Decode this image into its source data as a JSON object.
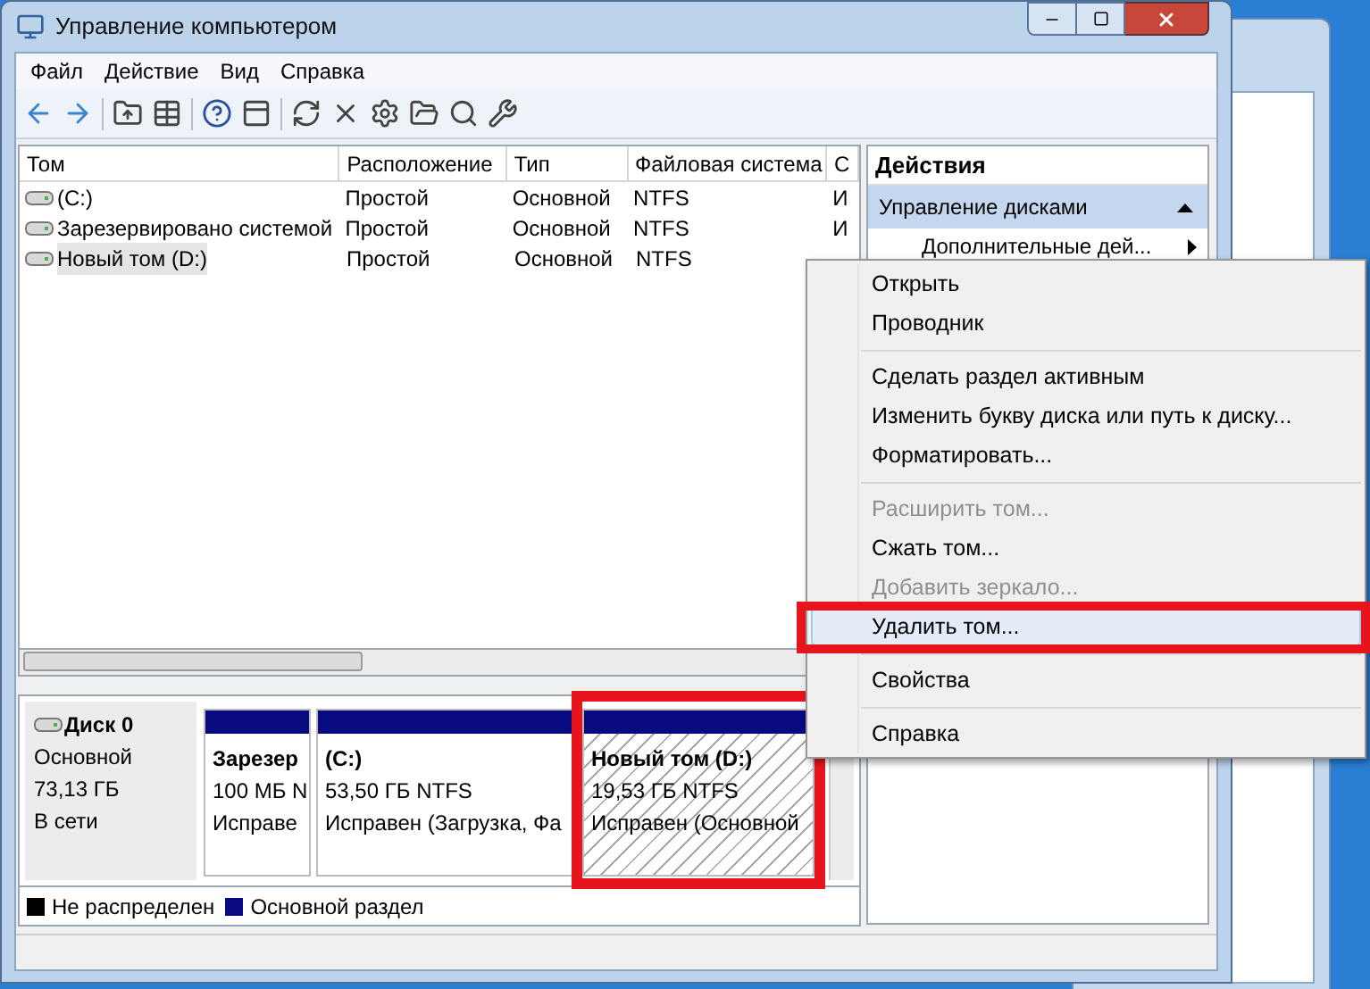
{
  "window": {
    "title": "Управление компьютером"
  },
  "menu_bar": [
    "Файл",
    "Действие",
    "Вид",
    "Справка"
  ],
  "volumes_table": {
    "columns": [
      "Том",
      "Расположение",
      "Тип",
      "Файловая система",
      "С"
    ],
    "rows": [
      {
        "cells": [
          "(C:)",
          "Простой",
          "Основной",
          "NTFS",
          "И"
        ],
        "selected": false
      },
      {
        "cells": [
          "Зарезервировано системой",
          "Простой",
          "Основной",
          "NTFS",
          "И"
        ],
        "selected": false
      },
      {
        "cells": [
          "Новый том (D:)",
          "Простой",
          "Основной",
          "NTFS"
        ],
        "selected": true
      }
    ]
  },
  "disk": {
    "name": "Диск 0",
    "type": "Основной",
    "size": "73,13 ГБ",
    "status": "В сети",
    "partitions": [
      {
        "name": "Зарезер",
        "size": "100 МБ N",
        "status": "Исправе",
        "hatched": false,
        "annotated": false
      },
      {
        "name": "(C:)",
        "size": "53,50 ГБ NTFS",
        "status": "Исправен (Загрузка, Фа",
        "hatched": false,
        "annotated": false
      },
      {
        "name": "Новый том  (D:)",
        "size": "19,53 ГБ NTFS",
        "status": "Исправен (Основной",
        "hatched": true,
        "annotated": true
      }
    ]
  },
  "legend": [
    {
      "label": "Не распределен",
      "color": "#000000"
    },
    {
      "label": "Основной раздел",
      "color": "#0a0a80"
    }
  ],
  "actions_pane": {
    "title": "Действия",
    "section": "Управление дисками",
    "item": "Дополнительные дей..."
  },
  "context_menu": [
    {
      "kind": "item",
      "label": "Открыть",
      "disabled": false,
      "selected": false,
      "annotated": false
    },
    {
      "kind": "item",
      "label": "Проводник",
      "disabled": false,
      "selected": false,
      "annotated": false
    },
    {
      "kind": "separator"
    },
    {
      "kind": "item",
      "label": "Сделать раздел активным",
      "disabled": false,
      "selected": false,
      "annotated": false
    },
    {
      "kind": "item",
      "label": "Изменить букву диска или путь к диску...",
      "disabled": false,
      "selected": false,
      "annotated": false
    },
    {
      "kind": "item",
      "label": "Форматировать...",
      "disabled": false,
      "selected": false,
      "annotated": false
    },
    {
      "kind": "separator"
    },
    {
      "kind": "item",
      "label": "Расширить том...",
      "disabled": true,
      "selected": false,
      "annotated": false
    },
    {
      "kind": "item",
      "label": "Сжать том...",
      "disabled": false,
      "selected": false,
      "annotated": false
    },
    {
      "kind": "item",
      "label": "Добавить зеркало...",
      "disabled": true,
      "selected": false,
      "annotated": false
    },
    {
      "kind": "item",
      "label": "Удалить том...",
      "disabled": false,
      "selected": true,
      "annotated": true
    },
    {
      "kind": "separator"
    },
    {
      "kind": "item",
      "label": "Свойства",
      "disabled": false,
      "selected": false,
      "annotated": false
    },
    {
      "kind": "separator"
    },
    {
      "kind": "item",
      "label": "Справка",
      "disabled": false,
      "selected": false,
      "annotated": false
    }
  ]
}
